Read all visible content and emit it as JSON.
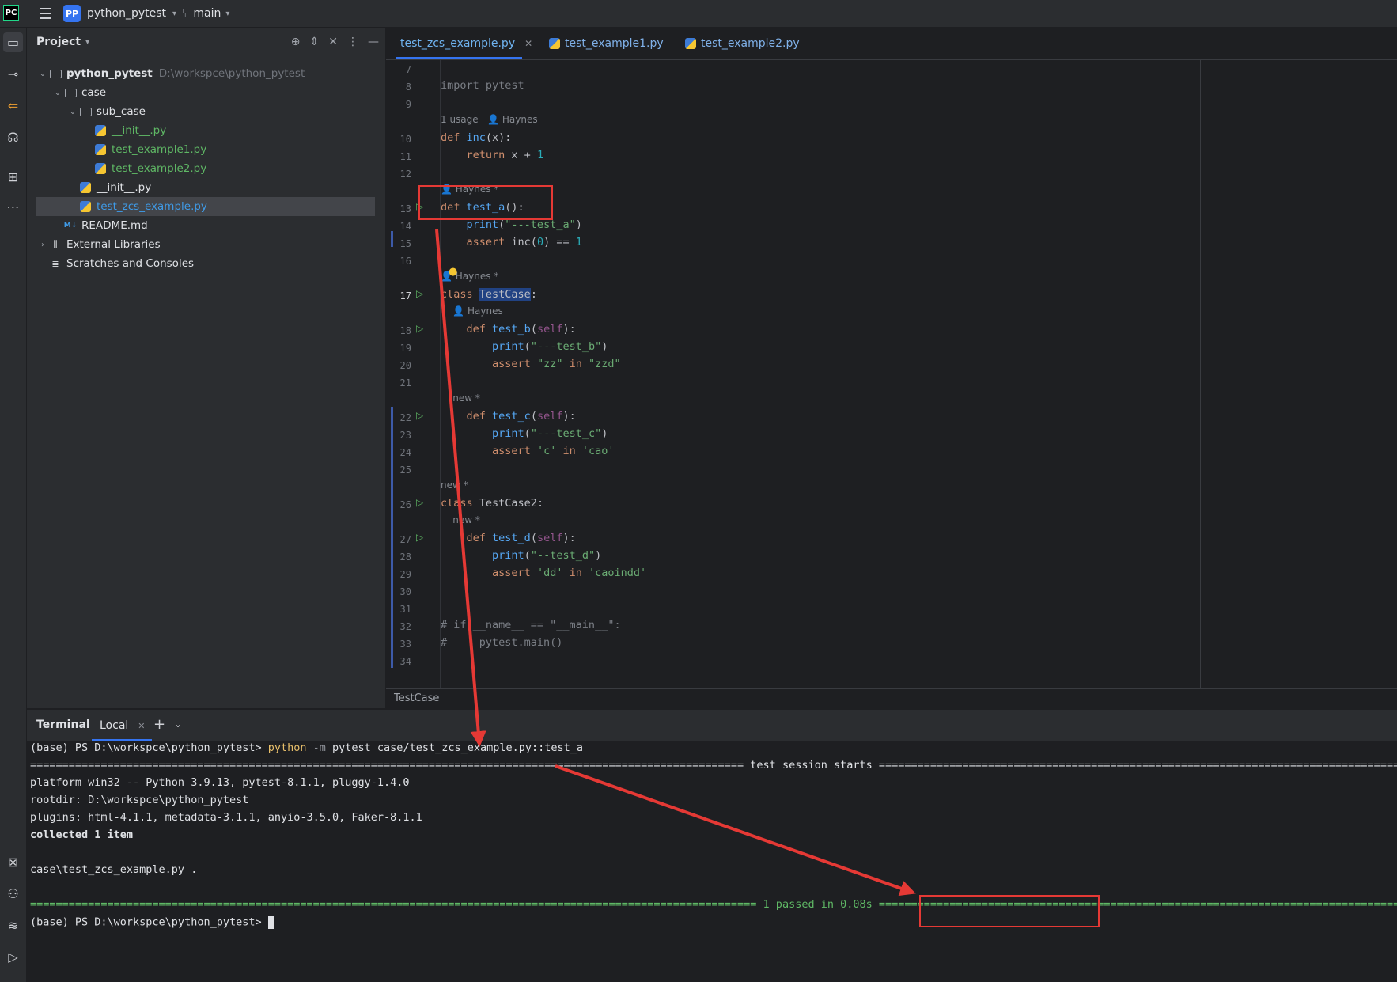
{
  "titlebar": {
    "logo": "PC",
    "project_badge": "PP",
    "project_name": "python_pytest",
    "branch": "main"
  },
  "project_panel": {
    "title": "Project",
    "tree": [
      {
        "label": "python_pytest",
        "hint": "D:\\workspce\\python_pytest",
        "type": "folder",
        "depth": 0,
        "expanded": true,
        "bold": true
      },
      {
        "label": "case",
        "type": "folder",
        "depth": 1,
        "expanded": true
      },
      {
        "label": "sub_case",
        "type": "folder",
        "depth": 2,
        "expanded": true
      },
      {
        "label": "__init__.py",
        "type": "py",
        "depth": 3,
        "color": "green"
      },
      {
        "label": "test_example1.py",
        "type": "py",
        "depth": 3,
        "color": "green"
      },
      {
        "label": "test_example2.py",
        "type": "py",
        "depth": 3,
        "color": "green"
      },
      {
        "label": "__init__.py",
        "type": "py",
        "depth": 2,
        "color": "normal"
      },
      {
        "label": "test_zcs_example.py",
        "type": "py",
        "depth": 2,
        "color": "blue",
        "selected": true
      },
      {
        "label": "README.md",
        "type": "md",
        "depth": 1,
        "icon_text": "M↓"
      },
      {
        "label": "External Libraries",
        "type": "lib",
        "depth": 0,
        "collapsed": true
      },
      {
        "label": "Scratches and Consoles",
        "type": "scratch",
        "depth": 0
      }
    ]
  },
  "tabs": [
    {
      "label": "test_zcs_example.py",
      "active": true,
      "closable": true
    },
    {
      "label": "test_example1.py",
      "active": false
    },
    {
      "label": "test_example2.py",
      "active": false
    }
  ],
  "editor": {
    "line_numbers": [
      "7",
      "8",
      "9",
      "10",
      "11",
      "12",
      "13",
      "14",
      "15",
      "16",
      "17",
      "18",
      "19",
      "20",
      "21",
      "22",
      "23",
      "24",
      "25",
      "26",
      "27",
      "28",
      "29",
      "30",
      "31",
      "32",
      "33",
      "34"
    ],
    "hints": {
      "usage": "1 usage",
      "author": "Haynes",
      "author_mod": "Haynes *",
      "new_mod": "new *"
    },
    "code": {
      "import": "import pytest",
      "l10_kw": "def ",
      "l10_fn": "inc",
      "l10_rest": "(x):",
      "l11_kw": "return",
      "l11_rest": " x + ",
      "l11_num": "1",
      "l13_kw": "def ",
      "l13_fn": "test_a",
      "l13_rest": "():",
      "l14_fn": "print",
      "l14_a": "(",
      "l14_str": "\"---test_a\"",
      "l14_b": ")",
      "l15_kw": "assert",
      "l15_rest": " inc(",
      "l15_num0": "0",
      "l15_rest2": ") == ",
      "l15_num1": "1",
      "l17_kw": "class ",
      "l17_name": "TestCase",
      "l17_rest": ":",
      "l18_kw": "def ",
      "l18_fn": "test_b",
      "l18_a": "(",
      "l18_self": "self",
      "l18_b": "):",
      "l19_fn": "print",
      "l19_a": "(",
      "l19_str": "\"---test_b\"",
      "l19_b": ")",
      "l20_kw": "assert",
      "l20_s1": " \"zz\"",
      "l20_in": " in ",
      "l20_s2": "\"zzd\"",
      "l22_kw": "def ",
      "l22_fn": "test_c",
      "l22_a": "(",
      "l22_self": "self",
      "l22_b": "):",
      "l23_fn": "print",
      "l23_a": "(",
      "l23_str": "\"---test_c\"",
      "l23_b": ")",
      "l24_kw": "assert",
      "l24_s1": " 'c'",
      "l24_in": " in ",
      "l24_s2": "'cao'",
      "l26_kw": "class ",
      "l26_name": "TestCase2",
      "l26_rest": ":",
      "l27_kw": "def ",
      "l27_fn": "test_d",
      "l27_a": "(",
      "l27_self": "self",
      "l27_b": "):",
      "l28_fn": "print",
      "l28_a": "(",
      "l28_str": "\"--test_d\"",
      "l28_b": ")",
      "l29_kw": "assert",
      "l29_s1": " 'dd'",
      "l29_in": " in ",
      "l29_s2": "'caoindd'",
      "l32": "# if __name__ == \"__main__\":",
      "l33": "#     pytest.main()"
    },
    "breadcrumb": "TestCase"
  },
  "terminal": {
    "title": "Terminal",
    "tab": "Local",
    "prompt": "(base) PS D:\\workspce\\python_pytest> ",
    "cmd_word": "python",
    "cmd_flag": " -m",
    "cmd_rest": " pytest case/test_zcs_example.py::test_a",
    "session_line": "=============================================================================================================== test session starts ====================================================================================",
    "platform": "platform win32 -- Python 3.9.13, pytest-8.1.1, pluggy-1.4.0",
    "rootdir": "rootdir: D:\\workspce\\python_pytest",
    "plugins": "plugins: html-4.1.1, metadata-3.1.1, anyio-3.5.0, Faker-8.1.1",
    "collected": "collected 1 item",
    "result_file": "case\\test_zcs_example.py .",
    "passed_line": "================================================================================================================= 1 passed in 0.08s ======================================================================================",
    "final_prompt": "(base) PS D:\\workspce\\python_pytest> "
  },
  "colors": {
    "annotation": "#e53935",
    "accent": "#3574f0",
    "pass": "#5fb865"
  }
}
